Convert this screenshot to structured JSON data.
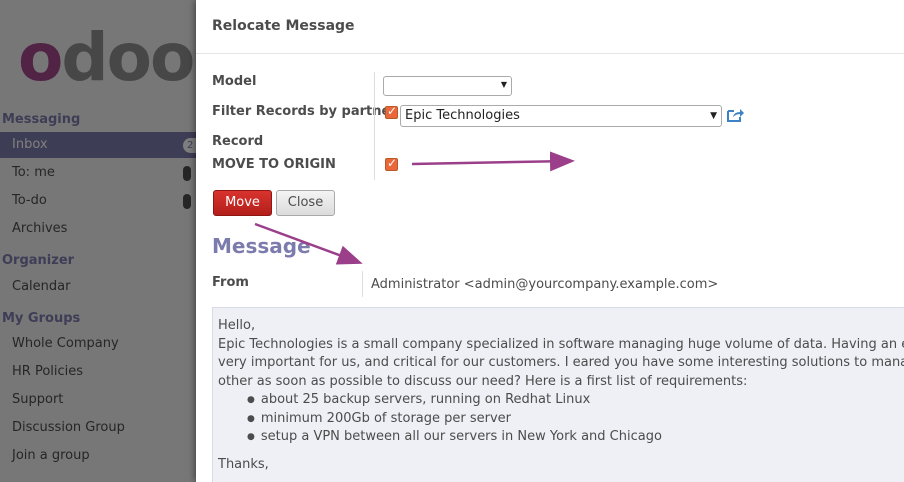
{
  "sidebar": {
    "logo": "odoo",
    "sections": [
      {
        "title": "Messaging"
      },
      {
        "title": "Organizer"
      },
      {
        "title": "My Groups"
      }
    ],
    "items": [
      {
        "label": "Inbox",
        "badge": "2"
      },
      {
        "label": "To: me",
        "badge": ""
      },
      {
        "label": "To-do",
        "badge": ""
      },
      {
        "label": "Archives"
      },
      {
        "label": "Calendar"
      },
      {
        "label": "Whole Company"
      },
      {
        "label": "HR Policies"
      },
      {
        "label": "Support"
      },
      {
        "label": "Discussion Group"
      },
      {
        "label": "Join a group"
      }
    ]
  },
  "dialog": {
    "title": "Relocate Message",
    "fields": {
      "model_label": "Model",
      "model_value": "",
      "filter_label": "Filter Records by partner",
      "filter_checked": true,
      "partner_value": "Epic Technologies",
      "record_label": "Record",
      "move_origin_label": "MOVE TO ORIGIN",
      "move_origin_checked": true
    },
    "buttons": {
      "move": "Move",
      "close": "Close"
    },
    "message": {
      "section_title": "Message",
      "from_label": "From",
      "from_value": "Administrator <admin@yourcompany.example.com>",
      "greeting": "Hello,",
      "line1": "Epic Technologies is a small company specialized in software managing huge volume of data. Having an efficient an",
      "line2": "very important for us, and critical for our customers. I eared you have some interesting solutions to manage our bac",
      "line3": "other as soon as possible to discuss our need? Here is a first list of requirements:",
      "requirements": [
        "about 25 backup servers, running on Redhat Linux",
        "minimum 200Gb of storage per server",
        "setup a VPN between all our servers in New York and Chicago"
      ],
      "closing": "Thanks,"
    }
  },
  "colors": {
    "accent": "#7c7bad",
    "move_button": "#c9282d",
    "checkbox": "#e9673a",
    "annotation_arrow": "#9b3f8a"
  }
}
